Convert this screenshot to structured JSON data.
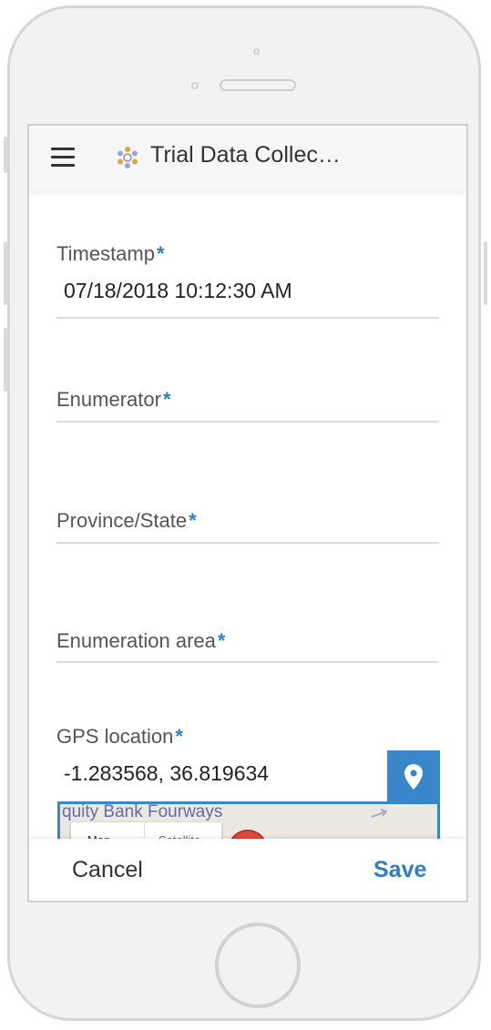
{
  "app_bar": {
    "title": "Trial Data Collec…",
    "menu_icon": "hamburger-menu-icon",
    "logo_icon": "app-logo-icon"
  },
  "form": {
    "timestamp": {
      "label": "Timestamp",
      "required_mark": "*",
      "value": "07/18/2018 10:12:30 AM"
    },
    "enumerator": {
      "label": "Enumerator",
      "required_mark": "*",
      "value": ""
    },
    "province_state": {
      "label": "Province/State",
      "required_mark": "*",
      "value": ""
    },
    "enumeration_area": {
      "label": "Enumeration area",
      "required_mark": "*",
      "value": ""
    },
    "gps_location": {
      "label": "GPS location",
      "required_mark": "*",
      "value": "-1.283568, 36.819634",
      "locate_icon": "location-pin-icon"
    }
  },
  "map": {
    "road_label": "quity Bank Fourways",
    "tab_map": "Map",
    "tab_satellite": "Satellite"
  },
  "actions": {
    "cancel_label": "Cancel",
    "save_label": "Save"
  },
  "colors": {
    "accent": "#3a86cb",
    "required": "#2f7fc1",
    "marker": "#e24a3d"
  }
}
